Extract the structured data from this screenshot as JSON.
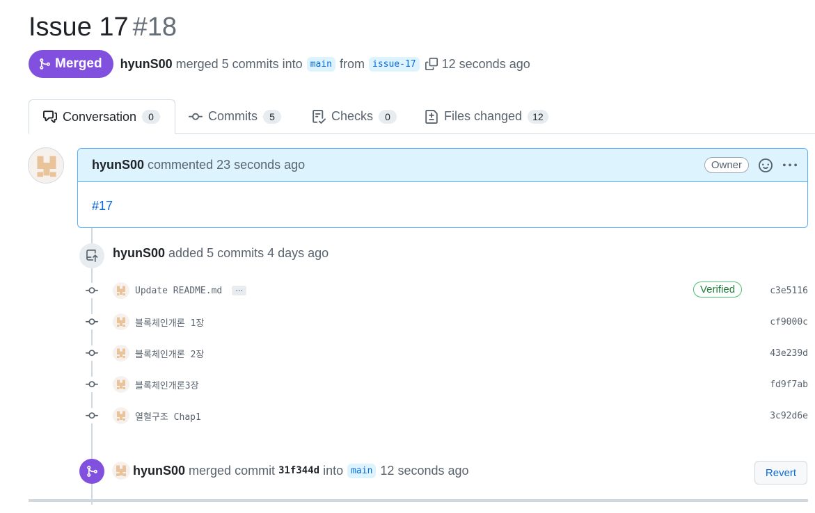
{
  "pr": {
    "title": "Issue 17",
    "number": "#18",
    "state": "Merged",
    "author": "hyunS00",
    "summary": "merged 5 commits into",
    "base_branch": "main",
    "from_word": "from",
    "head_branch": "issue-17",
    "time": "12 seconds ago"
  },
  "tabs": [
    {
      "label": "Conversation",
      "count": "0",
      "icon": "comment-discussion-icon",
      "active": true
    },
    {
      "label": "Commits",
      "count": "5",
      "icon": "git-commit-icon"
    },
    {
      "label": "Checks",
      "count": "0",
      "icon": "checklist-icon"
    },
    {
      "label": "Files changed",
      "count": "12",
      "icon": "file-diff-icon"
    }
  ],
  "comment": {
    "author": "hyunS00",
    "action": "commented 23 seconds ago",
    "badge": "Owner",
    "body_link": "#17"
  },
  "added": {
    "author": "hyunS00",
    "text": "added 5 commits 4 days ago"
  },
  "commits": [
    {
      "message": "Update README.md",
      "sha": "c3e5116",
      "verified": "Verified",
      "has_more": "···"
    },
    {
      "message": "블록체인개론 1장",
      "sha": "cf9000c"
    },
    {
      "message": "블록체인개론 2장",
      "sha": "43e239d"
    },
    {
      "message": "블록체인개론3장",
      "sha": "fd9f7ab"
    },
    {
      "message": "열혈구조 Chap1",
      "sha": "3c92d6e"
    }
  ],
  "merge_event": {
    "author": "hyunS00",
    "text1": "merged commit",
    "sha": "31f344d",
    "text2": "into",
    "branch": "main",
    "time": "12 seconds ago",
    "revert_label": "Revert"
  },
  "colors": {
    "merged": "#8250df",
    "link": "#0969da",
    "verified": "#1a7f37",
    "avatar": "#e9c39a"
  }
}
